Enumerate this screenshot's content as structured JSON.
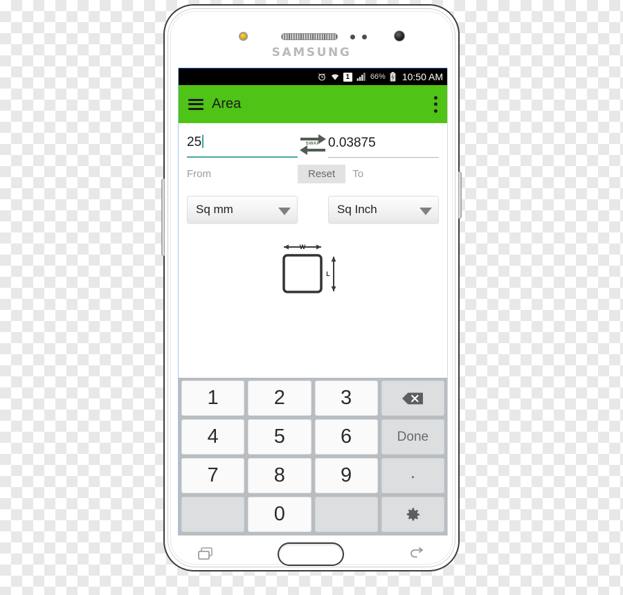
{
  "device": {
    "brand": "SAMSUNG",
    "frame_color": "#ffffff"
  },
  "status_bar": {
    "background": "#000000",
    "icons": [
      "alarm-icon",
      "wifi-icon",
      "sim-1-icon",
      "signal-bars-icon",
      "battery-icon"
    ],
    "sim_label": "1",
    "battery_percent": "66%",
    "clock": "10:50 AM"
  },
  "app_bar": {
    "background": "#4fc316",
    "title": "Area",
    "menu_icon": "hamburger-icon",
    "overflow_icon": "overflow-menu-icon"
  },
  "converter": {
    "from": {
      "value": "25",
      "label": "From",
      "unit": "Sq mm",
      "underline_color": "#49a8a2"
    },
    "to": {
      "value": "0.03875",
      "label": "To",
      "unit": "Sq Inch",
      "underline_color": "#b5b5b5"
    },
    "swap_label": "SWAP",
    "reset_label": "Reset",
    "diagram": {
      "width_label": "W",
      "length_label": "L"
    }
  },
  "keypad": {
    "rows": [
      [
        {
          "label": "1",
          "type": "num",
          "name": "key-1"
        },
        {
          "label": "2",
          "type": "num",
          "name": "key-2"
        },
        {
          "label": "3",
          "type": "num",
          "name": "key-3"
        },
        {
          "label": "",
          "type": "backspace",
          "name": "key-backspace"
        }
      ],
      [
        {
          "label": "4",
          "type": "num",
          "name": "key-4"
        },
        {
          "label": "5",
          "type": "num",
          "name": "key-5"
        },
        {
          "label": "6",
          "type": "num",
          "name": "key-6"
        },
        {
          "label": "Done",
          "type": "func",
          "name": "key-done"
        }
      ],
      [
        {
          "label": "7",
          "type": "num",
          "name": "key-7"
        },
        {
          "label": "8",
          "type": "num",
          "name": "key-8"
        },
        {
          "label": "9",
          "type": "num",
          "name": "key-9"
        },
        {
          "label": ".",
          "type": "dot",
          "name": "key-period"
        }
      ],
      [
        {
          "label": "",
          "type": "blank",
          "name": "key-blank-left"
        },
        {
          "label": "0",
          "type": "num",
          "name": "key-0"
        },
        {
          "label": "",
          "type": "blank",
          "name": "key-blank-right"
        },
        {
          "label": "",
          "type": "gear",
          "name": "key-settings"
        }
      ]
    ]
  },
  "bottom_nav": {
    "recents_icon": "recents-icon",
    "home_key": "home-button",
    "back_icon": "back-icon"
  }
}
